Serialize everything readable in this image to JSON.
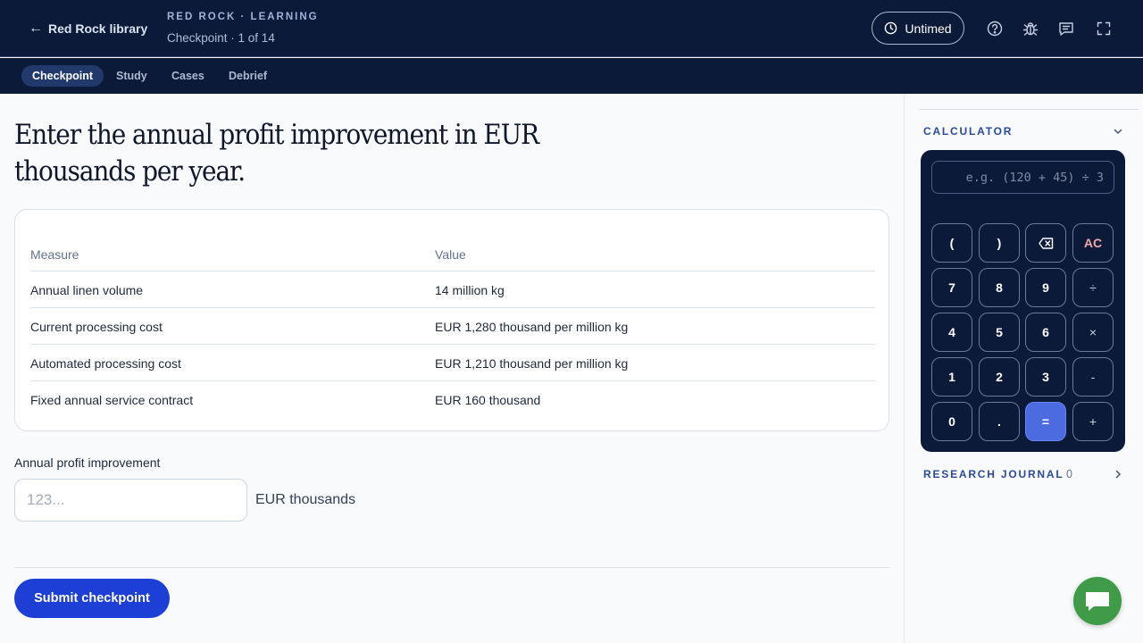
{
  "header": {
    "back_label": "Red Rock library",
    "brand": "RED ROCK · LEARNING",
    "progress": "Checkpoint · 1 of 14",
    "timer_label": "Untimed",
    "icons": [
      "help-icon",
      "bug-icon",
      "feedback-icon",
      "fullscreen-icon"
    ]
  },
  "tabs": [
    {
      "label": "Checkpoint",
      "active": true
    },
    {
      "label": "Study",
      "active": false
    },
    {
      "label": "Cases",
      "active": false
    },
    {
      "label": "Debrief",
      "active": false
    }
  ],
  "main": {
    "question": "Enter the annual profit improvement in EUR thousands per year.",
    "table": {
      "headers": [
        "Measure",
        "Value"
      ],
      "rows": [
        [
          "Annual linen volume",
          "14 million kg"
        ],
        [
          "Current processing cost",
          "EUR 1,280 thousand per million kg"
        ],
        [
          "Automated processing cost",
          "EUR 1,210 thousand per million kg"
        ],
        [
          "Fixed annual service contract",
          "EUR 160 thousand"
        ]
      ]
    },
    "answer": {
      "label": "Annual profit improvement",
      "placeholder": "123...",
      "value": "",
      "unit": "EUR thousands"
    },
    "submit_label": "Submit checkpoint"
  },
  "sidebar": {
    "calculator": {
      "title": "CALCULATOR",
      "display_placeholder": "e.g. (120 + 45) ÷ 3",
      "keys": [
        [
          "(",
          ")",
          "⌫",
          "AC"
        ],
        [
          "7",
          "8",
          "9",
          "÷"
        ],
        [
          "4",
          "5",
          "6",
          "×"
        ],
        [
          "1",
          "2",
          "3",
          "-"
        ],
        [
          "0",
          ".",
          "=",
          "+"
        ]
      ]
    },
    "journal": {
      "title": "RESEARCH JOURNAL",
      "count": "0"
    }
  },
  "colors": {
    "header_bg": "#0c1a3a",
    "accent": "#1d3fd6",
    "equals_key": "#4d6be0",
    "chat_button": "#3f9b47"
  }
}
